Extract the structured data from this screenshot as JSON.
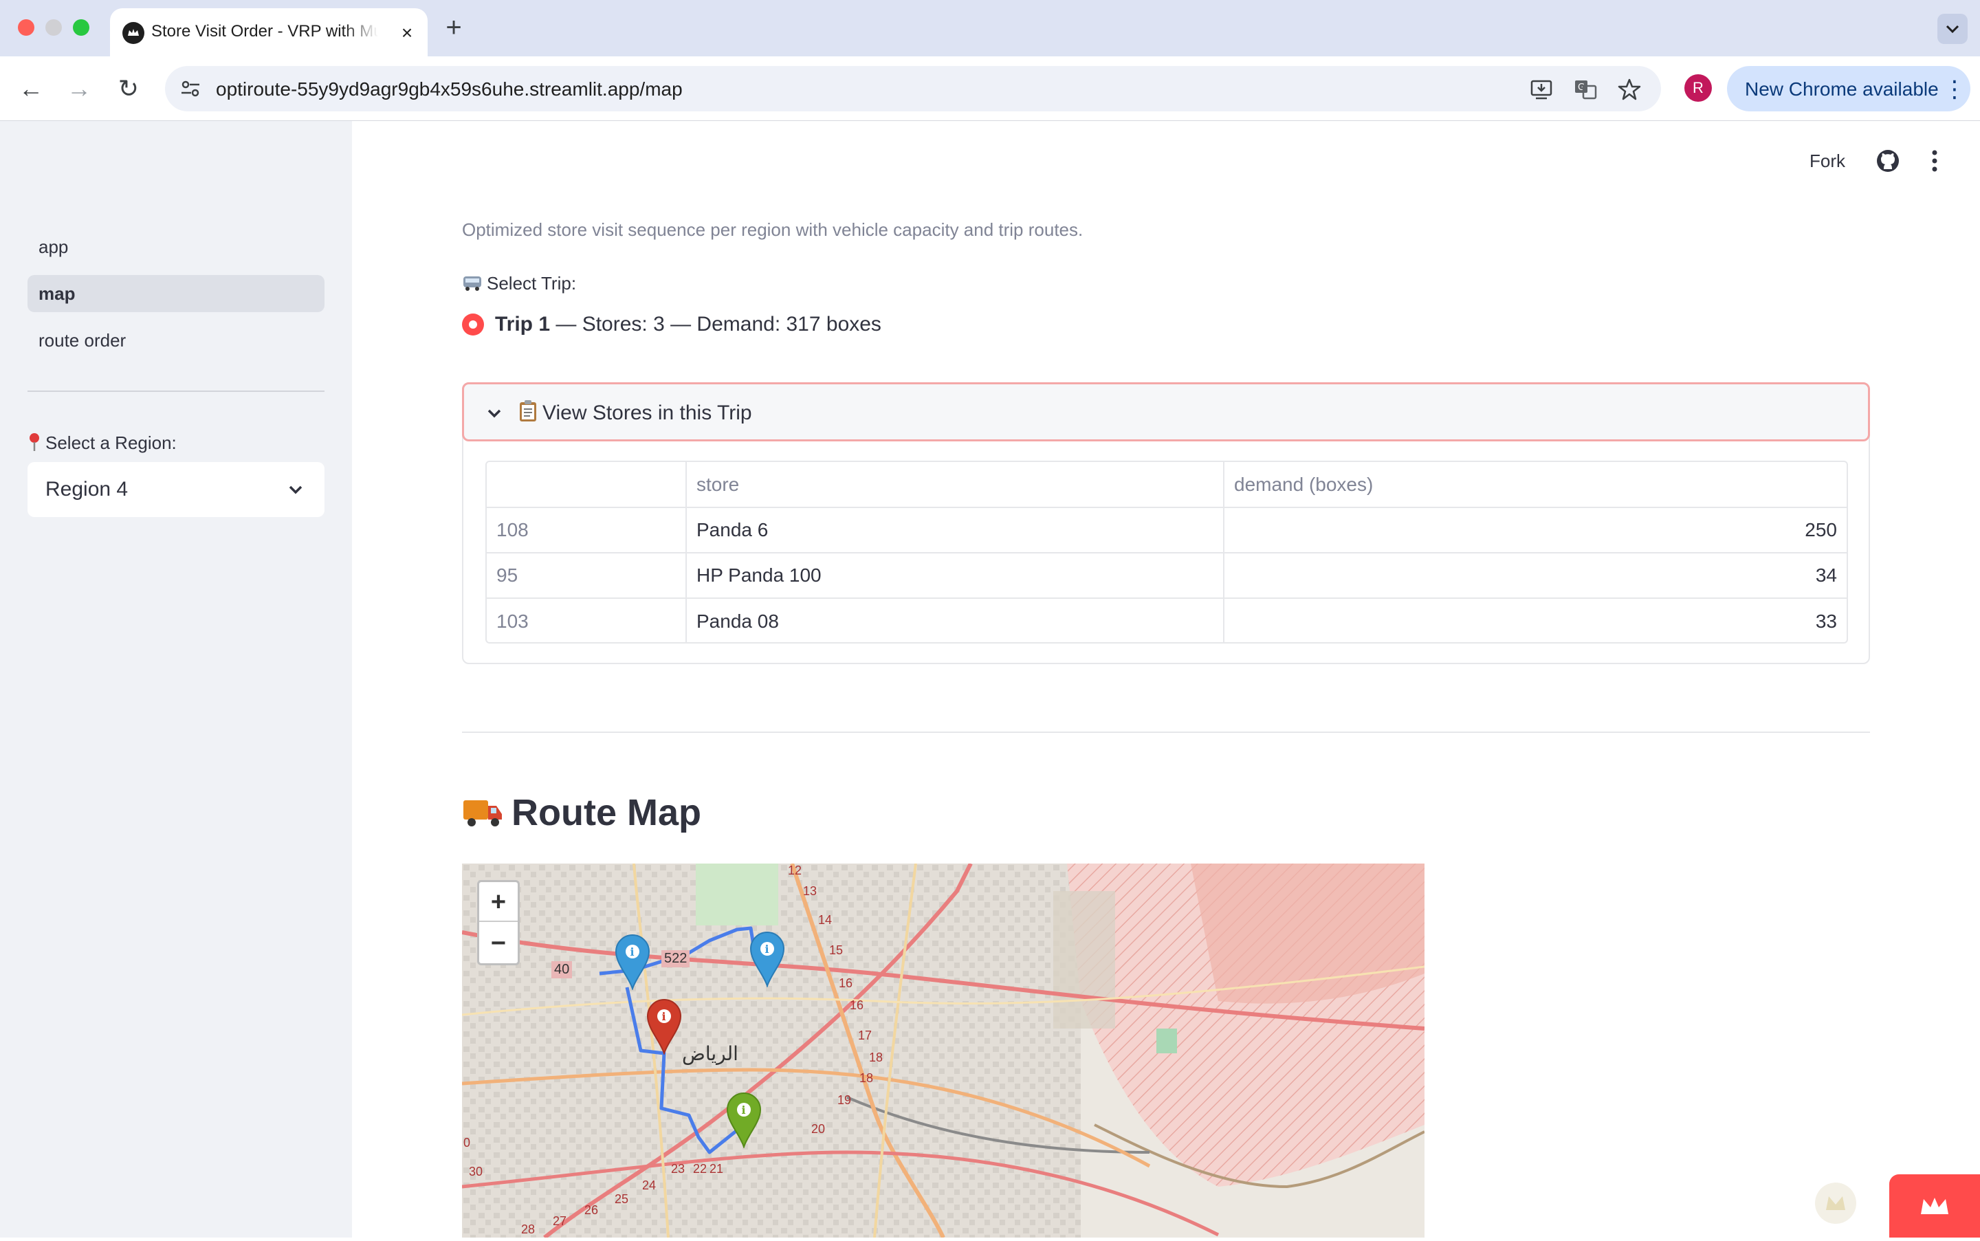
{
  "browser": {
    "tab_title": "Store Visit Order - VRP with Multi",
    "new_tab": "+",
    "close": "×",
    "url": "optiroute-55y9yd9agr9gb4x59s6uhe.streamlit.app/map",
    "profile_initial": "R",
    "update_label": "New Chrome available",
    "back": "←",
    "forward": "→",
    "reload": "↻",
    "menu": "⋮"
  },
  "sidebar": {
    "nav": [
      {
        "label": "app",
        "active": false
      },
      {
        "label": "map",
        "active": true
      },
      {
        "label": "route order",
        "active": false
      }
    ],
    "region_label": "Select a Region:",
    "region_value": "Region 4"
  },
  "header": {
    "fork": "Fork"
  },
  "main": {
    "caption": "Optimized store visit sequence per region with vehicle capacity and trip routes.",
    "trip_label": "Select Trip:",
    "trip_option_bold": "Trip 1",
    "trip_option_rest": " — Stores: 3 — Demand: 317 boxes",
    "expander_title": "View Stores in this Trip",
    "table": {
      "columns": [
        "",
        "store",
        "demand (boxes)"
      ],
      "rows": [
        [
          "108",
          "Panda 6",
          "250"
        ],
        [
          "95",
          "HP Panda 100",
          "34"
        ],
        [
          "103",
          "Panda 08",
          "33"
        ]
      ]
    },
    "map_heading": "Route Map"
  },
  "map": {
    "zoom_in": "+",
    "zoom_out": "−",
    "city_label": "الرياض",
    "road_labels": [
      "40",
      "522",
      "12",
      "13",
      "14",
      "15",
      "16",
      "16",
      "17",
      "18",
      "18",
      "19",
      "20",
      "21",
      "22",
      "23",
      "24",
      "25",
      "26",
      "27",
      "28",
      "30",
      "0"
    ],
    "markers": [
      {
        "color": "#3a9ad9",
        "icon": "info-icon"
      },
      {
        "color": "#3a9ad9",
        "icon": "info-icon"
      },
      {
        "color": "#cf3c2a",
        "icon": "info-icon"
      },
      {
        "color": "#71ab26",
        "icon": "info-icon"
      }
    ],
    "route_color": "#4a7dea"
  },
  "colors": {
    "accent": "#ff4b4b",
    "sidebar_bg": "#f0f2f6",
    "text": "#31333f",
    "muted": "#808495"
  }
}
